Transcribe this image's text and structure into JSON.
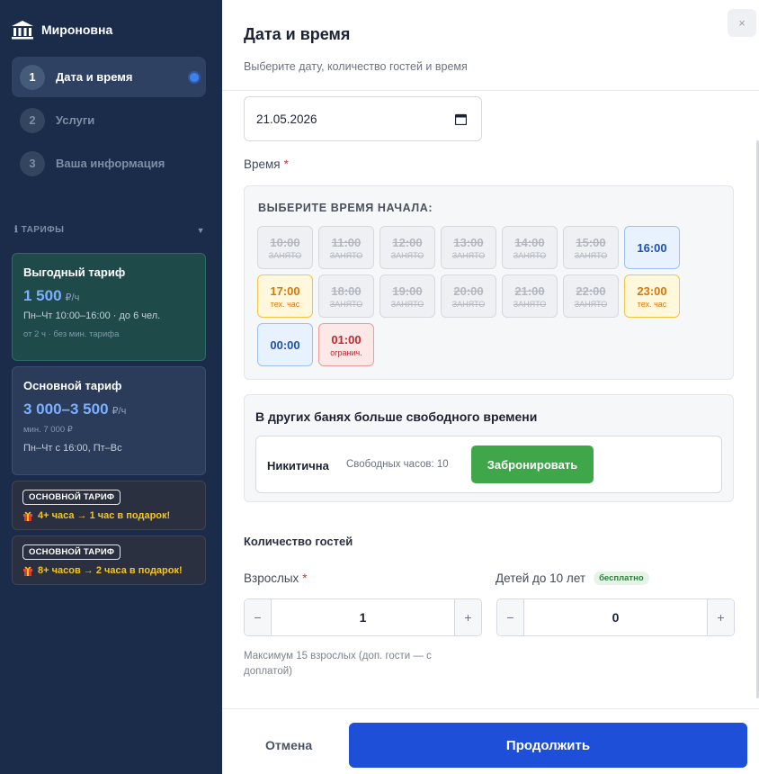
{
  "sidebar": {
    "brand": "Мироновна",
    "steps": [
      {
        "num": "1",
        "label": "Дата и время"
      },
      {
        "num": "2",
        "label": "Услуги"
      },
      {
        "num": "3",
        "label": "Ваша информация"
      }
    ],
    "tariffs_header": "ТАРИФЫ",
    "tariffs_icon": "ℹ",
    "cards": [
      {
        "title": "Выгодный тариф",
        "price": "1 500",
        "unit": "₽/ч",
        "line": "Пн–Чт 10:00–16:00 · до 6 чел.",
        "small": "от 2 ч · без мин. тарифа"
      },
      {
        "title": "Основной тариф",
        "price": "3 000–3 500",
        "unit": "₽/ч",
        "small": "мин. 7 000 ₽",
        "line": "Пн–Чт с 16:00, Пт–Вс"
      }
    ],
    "promos": [
      {
        "badge": "ОСНОВНОЙ ТАРИФ",
        "text": "4+ часа → 1 час в подарок!"
      },
      {
        "badge": "ОСНОВНОЙ ТАРИФ",
        "text": "8+ часов → 2 часа в подарок!"
      }
    ]
  },
  "main": {
    "close": "×",
    "title": "Дата и время",
    "subtitle": "Выберите дату, количество гостей и время",
    "date_value": "21.05.2026",
    "time_label": "Время",
    "required_mark": "*",
    "time_box_title": "ВЫБЕРИТЕ ВРЕМЯ НАЧАЛА:",
    "slots": [
      {
        "time": "10:00",
        "sub": "ЗАНЯТО"
      },
      {
        "time": "11:00",
        "sub": "ЗАНЯТО"
      },
      {
        "time": "12:00",
        "sub": "ЗАНЯТО"
      },
      {
        "time": "13:00",
        "sub": "ЗАНЯТО"
      },
      {
        "time": "14:00",
        "sub": "ЗАНЯТО"
      },
      {
        "time": "15:00",
        "sub": "ЗАНЯТО"
      },
      {
        "time": "16:00",
        "sub": ""
      },
      {
        "time": "17:00",
        "sub": "тех. час"
      },
      {
        "time": "18:00",
        "sub": "ЗАНЯТО"
      },
      {
        "time": "19:00",
        "sub": "ЗАНЯТО"
      },
      {
        "time": "20:00",
        "sub": "ЗАНЯТО"
      },
      {
        "time": "21:00",
        "sub": "ЗАНЯТО"
      },
      {
        "time": "22:00",
        "sub": "ЗАНЯТО"
      },
      {
        "time": "23:00",
        "sub": "тех. час"
      },
      {
        "time": "00:00",
        "sub": ""
      },
      {
        "time": "01:00",
        "sub": "огранич."
      }
    ],
    "other": {
      "title": "В других банях больше свободного времени",
      "name": "Никитична",
      "hours": "Свободных часов: 10",
      "button": "Забронировать"
    },
    "guests_title": "Количество гостей",
    "adults_label": "Взрослых",
    "adults_value": "1",
    "kids_label": "Детей до 10 лет",
    "kids_badge": "бесплатно",
    "kids_value": "0",
    "stepper_minus": "−",
    "stepper_plus": "+",
    "hint": "Максимум 15 взрослых (доп. гости — с доплатой)",
    "cancel": "Отмена",
    "continue": "Продолжить"
  }
}
